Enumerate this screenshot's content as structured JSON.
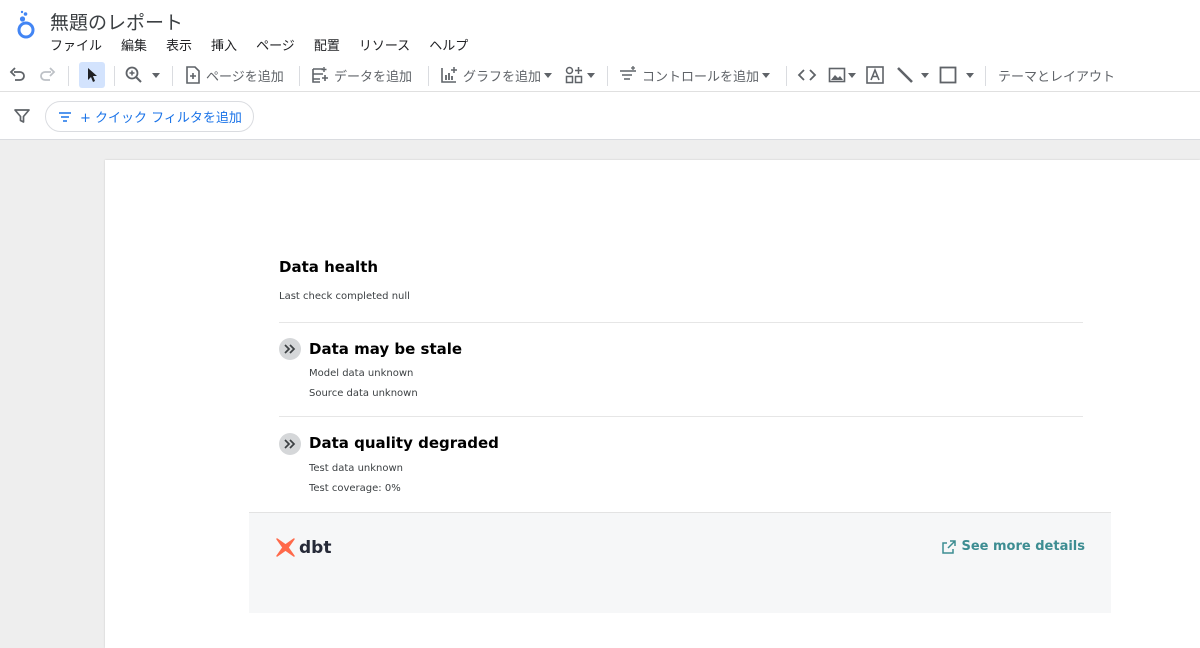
{
  "app": {
    "title": "無題のレポート",
    "menu": [
      "ファイル",
      "編集",
      "表示",
      "挿入",
      "ページ",
      "配置",
      "リソース",
      "ヘルプ"
    ]
  },
  "toolbar": {
    "add_page": "ページを追加",
    "add_data": "データを追加",
    "add_chart": "グラフを追加",
    "add_control": "コントロールを追加",
    "theme_layout": "テーマとレイアウト"
  },
  "filterbar": {
    "quick_filter": "+ クイック フィルタを追加"
  },
  "report": {
    "title": "Data health",
    "subtitle": "Last check completed null",
    "sections": [
      {
        "title": "Data may be stale",
        "lines": [
          "Model data unknown",
          "Source data unknown"
        ]
      },
      {
        "title": "Data quality degraded",
        "lines": [
          "Test data unknown",
          "Test coverage: 0%"
        ]
      }
    ],
    "footer": {
      "brand": "dbt",
      "link": "See more details"
    }
  },
  "colors": {
    "accent_blue": "#1a73e8",
    "link_teal": "#3d8d92",
    "dbt_orange": "#ff694a",
    "select_bg": "#d3e3fd"
  }
}
